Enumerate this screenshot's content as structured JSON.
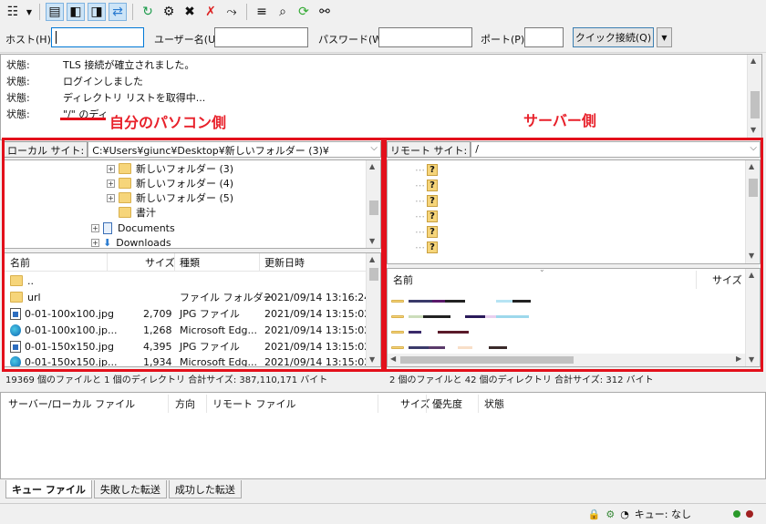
{
  "toolbar": {
    "icons": [
      "site-manager-icon",
      "dropdown-arrow-icon",
      "message-log-icon",
      "local-tree-icon",
      "remote-tree-icon",
      "transfer-queue-icon",
      "refresh-icon",
      "process-queue-icon",
      "cancel-icon",
      "disconnect-icon",
      "reconnect-icon",
      "filter-icon",
      "compare-icon",
      "sync-browse-icon",
      "search-icon"
    ]
  },
  "quickconnect": {
    "host_label": "ホスト(H):",
    "user_label": "ユーザー名(U):",
    "pass_label": "パスワード(W):",
    "port_label": "ポート(P):",
    "connect_button": "クイック接続(Q)",
    "host_value": "",
    "user_value": "",
    "pass_value": "",
    "port_value": ""
  },
  "log": [
    {
      "k": "状態:",
      "v": "TLS 接続が確立されました。"
    },
    {
      "k": "状態:",
      "v": "ログインしました"
    },
    {
      "k": "状態:",
      "v": "ディレクトリ リストを取得中..."
    },
    {
      "k": "状態:",
      "v": "\"/\" のディ"
    }
  ],
  "annotations": {
    "local": "自分のパソコン側",
    "remote": "サーバー側",
    "color": "#e3101b"
  },
  "local": {
    "path_label": "ローカル サイト:",
    "path_value": "C:¥Users¥giunc¥Desktop¥新しいフォルダー (3)¥",
    "tree": [
      "新しいフォルダー (3)",
      "新しいフォルダー (4)",
      "新しいフォルダー (5)",
      "書汁",
      "Documents",
      "Downloads"
    ],
    "columns": {
      "name": "名前",
      "size": "サイズ",
      "type": "種類",
      "date": "更新日時"
    },
    "files": [
      {
        "name": "..",
        "size": "",
        "type": "",
        "date": ""
      },
      {
        "name": "url",
        "size": "",
        "type": "ファイル フォルダー",
        "date": "2021/09/14 13:16:24"
      },
      {
        "name": "0-01-100x100.jpg",
        "size": "2,709",
        "type": "JPG ファイル",
        "date": "2021/09/14 13:15:02"
      },
      {
        "name": "0-01-100x100.jp...",
        "size": "1,268",
        "type": "Microsoft Edg...",
        "date": "2021/09/14 13:15:02"
      },
      {
        "name": "0-01-150x150.jpg",
        "size": "4,395",
        "type": "JPG ファイル",
        "date": "2021/09/14 13:15:02"
      },
      {
        "name": "0-01-150x150.jp...",
        "size": "1,934",
        "type": "Microsoft Edg...",
        "date": "2021/09/14 13:15:02"
      }
    ],
    "status": "19369 個のファイルと 1 個のディレクトリ 合計サイズ: 387,110,171 バイト"
  },
  "remote": {
    "path_label": "リモート サイト:",
    "path_value": "/",
    "columns": {
      "name": "名前",
      "size": "サイズ"
    },
    "status": "2 個のファイルと 42 個のディレクトリ 合計サイズ: 312 バイト"
  },
  "queue": {
    "columns": {
      "file": "サーバー/ローカル ファイル",
      "dir": "方向",
      "remote": "リモート ファイル",
      "size": "サイズ",
      "prio": "優先度",
      "state": "状態"
    },
    "tabs": [
      "キュー ファイル",
      "失敗した転送",
      "成功した転送"
    ]
  },
  "statusbar": {
    "queue": "キュー: なし"
  }
}
